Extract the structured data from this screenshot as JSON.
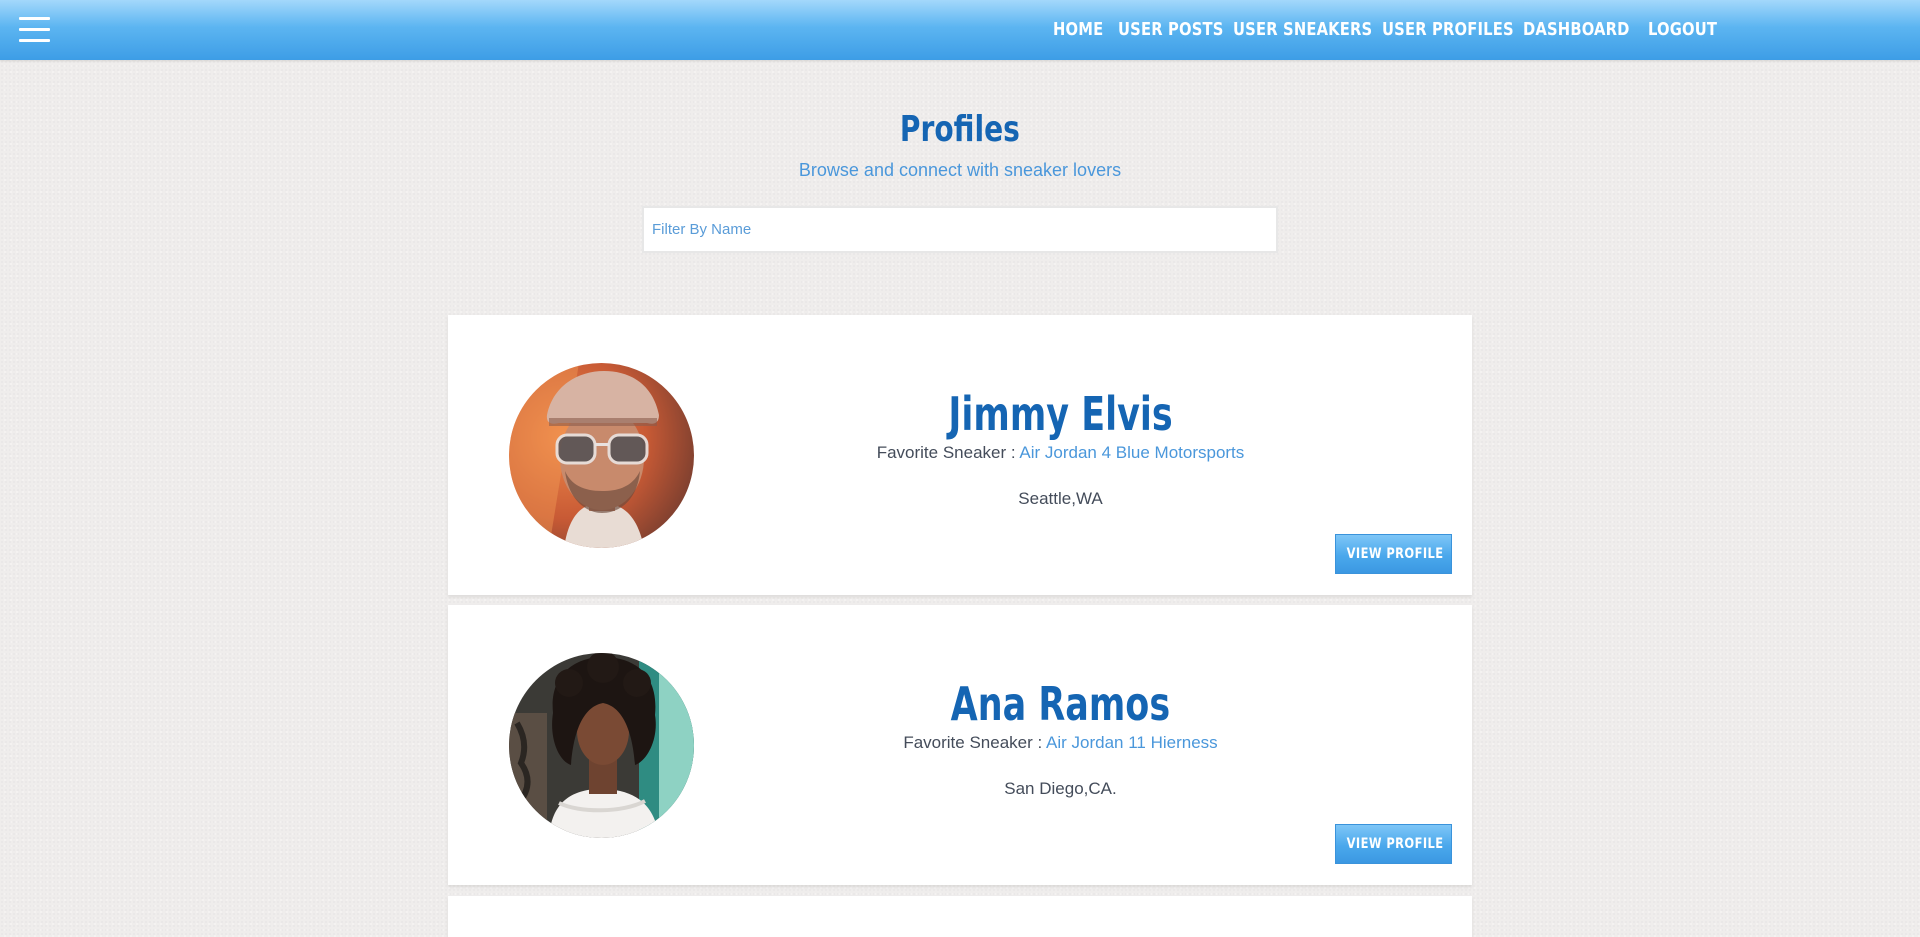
{
  "nav": {
    "menu_icon": "hamburger-menu-icon",
    "links": [
      "Home",
      "User Posts",
      "User Sneakers",
      "User Profiles",
      "Dashboard",
      "Logout"
    ]
  },
  "page": {
    "title": "Profiles",
    "subtitle": "Browse and connect with sneaker lovers"
  },
  "filter": {
    "placeholder": "Filter By Name",
    "value": ""
  },
  "profiles": [
    {
      "name": "Jimmy Elvis",
      "favorite_label": "Favorite Sneaker :",
      "favorite_sneaker": "Air Jordan 4 Blue Motorsports",
      "location": "Seattle,WA",
      "button_label": "View Profile"
    },
    {
      "name": "Ana Ramos",
      "favorite_label": "Favorite Sneaker :",
      "favorite_sneaker": "Air Jordan 11 Hierness",
      "location": "San Diego,CA.",
      "button_label": "View Profile"
    }
  ],
  "colors": {
    "nav_gradient_top": "#a3d8fb",
    "nav_gradient_bottom": "#3d9de6",
    "title_blue": "#1565b3",
    "accent_blue": "#4a97db",
    "body_text": "#444c5a",
    "background": "#efedec"
  }
}
